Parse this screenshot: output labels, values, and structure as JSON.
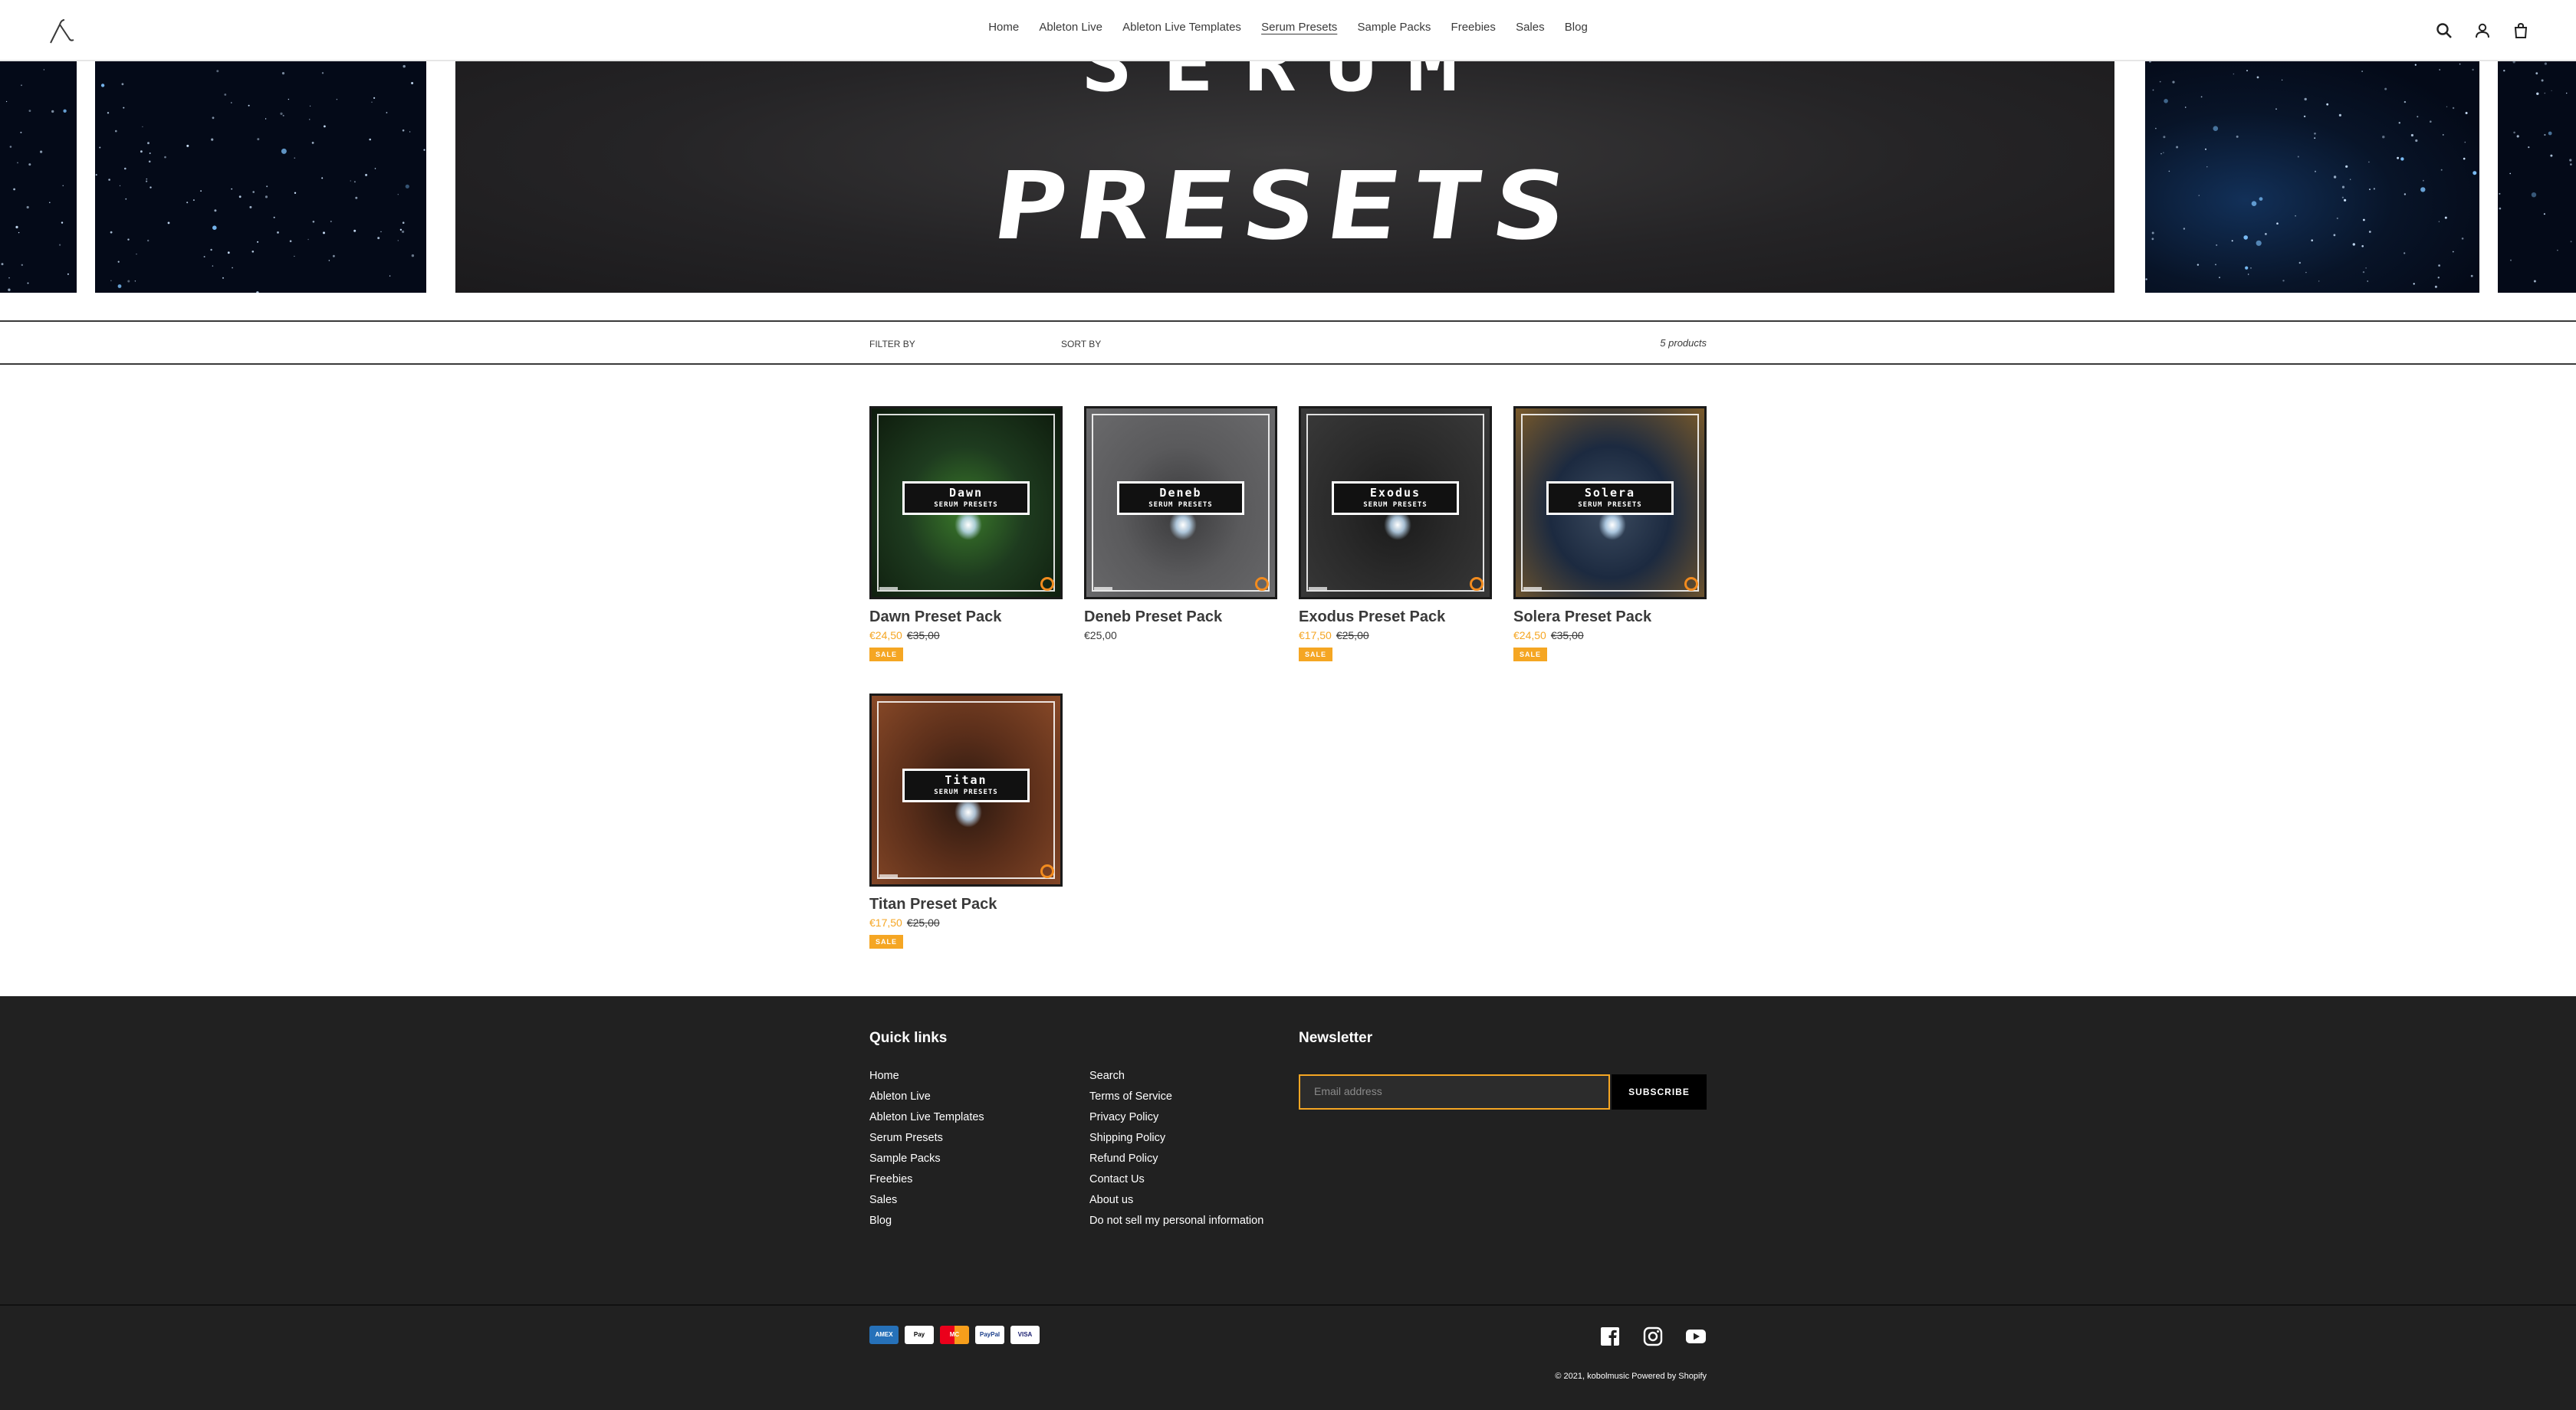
{
  "header": {
    "nav": [
      "Home",
      "Ableton Live",
      "Ableton Live Templates",
      "Serum Presets",
      "Sample Packs",
      "Freebies",
      "Sales",
      "Blog"
    ],
    "active_nav": "Serum Presets",
    "icons": [
      "search-icon",
      "account-icon",
      "cart-icon"
    ]
  },
  "hero": {
    "top_word_partial": "SERUM",
    "main_word": "PRESETS"
  },
  "filterbar": {
    "filter_label": "FILTER BY",
    "sort_label": "SORT BY",
    "count": "5 products"
  },
  "products": [
    {
      "name": "Dawn Preset Pack",
      "cover_name": "Dawn",
      "cover_sub": "SERUM PRESETS",
      "sale_price": "€24,50",
      "old_price": "€35,00",
      "badge": "SALE",
      "palette": [
        "#1e3b1f",
        "#3a7a2a",
        "#0d1a0c"
      ]
    },
    {
      "name": "Deneb Preset Pack",
      "cover_name": "Deneb",
      "cover_sub": "SERUM PRESETS",
      "price": "€25,00",
      "palette": [
        "#5a5a5c",
        "#3a3a3c",
        "#6b6b6d"
      ]
    },
    {
      "name": "Exodus Preset Pack",
      "cover_name": "Exodus",
      "cover_sub": "SERUM PRESETS",
      "sale_price": "€17,50",
      "old_price": "€25,00",
      "badge": "SALE",
      "palette": [
        "#2a2a2a",
        "#1a1a1a",
        "#3a3a3a"
      ]
    },
    {
      "name": "Solera Preset Pack",
      "cover_name": "Solera",
      "cover_sub": "SERUM PRESETS",
      "sale_price": "€24,50",
      "old_price": "€35,00",
      "badge": "SALE",
      "palette": [
        "#1c2a40",
        "#3b4a5e",
        "#7a5a2a"
      ]
    },
    {
      "name": "Titan Preset Pack",
      "cover_name": "Titan",
      "cover_sub": "SERUM PRESETS",
      "sale_price": "€17,50",
      "old_price": "€25,00",
      "badge": "SALE",
      "palette": [
        "#5a2e1a",
        "#2a1810",
        "#8a4a28"
      ]
    }
  ],
  "footer": {
    "quick_links_title": "Quick links",
    "links_col1": [
      "Home",
      "Ableton Live",
      "Ableton Live Templates",
      "Serum Presets",
      "Sample Packs",
      "Freebies",
      "Sales",
      "Blog"
    ],
    "links_col2": [
      "Search",
      "Terms of Service",
      "Privacy Policy",
      "Shipping Policy",
      "Refund Policy",
      "Contact Us",
      "About us",
      "Do not sell my personal information"
    ],
    "newsletter_title": "Newsletter",
    "email_placeholder": "Email address",
    "subscribe_label": "SUBSCRIBE",
    "payment_methods": [
      "AMEX",
      "Pay",
      "MC",
      "PayPal",
      "VISA"
    ],
    "social_icons": [
      "facebook-icon",
      "instagram-icon",
      "youtube-icon"
    ],
    "copyright": "© 2021, kobolmusic Powered by Shopify"
  },
  "colors": {
    "sale": "#f5a623",
    "footer_bg": "#212121",
    "text": "#3a3a3a"
  }
}
